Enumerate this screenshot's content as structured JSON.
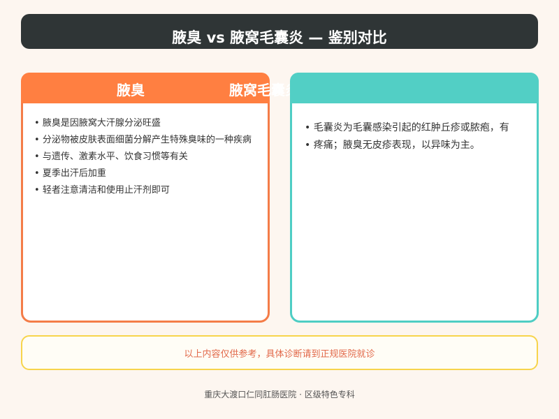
{
  "header": {
    "title": "腋臭 vs 腋窝毛囊炎 — 鉴别对比"
  },
  "left_card": {
    "title": "腋臭",
    "items": [
      "腋臭是因腋窝大汗腺分泌旺盛",
      "分泌物被皮肤表面细菌分解产生特殊臭味的一种疾病",
      "与遗传、激素水平、饮食习惯等有关",
      "夏季出汗后加重",
      "轻者注意清洁和使用止汗剂即可"
    ]
  },
  "right_card": {
    "title": "腋窝毛囊炎",
    "lines": [
      "• 毛囊炎为毛囊感染引起的红肿丘疹或脓疱，有",
      "• 疼痛；腋臭无皮疹表现，以异味为主。"
    ]
  },
  "notice": {
    "text": "以上内容仅供参考，具体诊断请到正规医院就诊"
  },
  "footer": {
    "text": "重庆大渡口仁同肛肠医院 · 区级特色专科"
  },
  "colors": {
    "title_bg": "#2f3536",
    "left_accent": "#ff7f41",
    "right_accent": "#52cfc5",
    "notice_border": "#f7d44c",
    "notice_text": "#e2694a"
  }
}
